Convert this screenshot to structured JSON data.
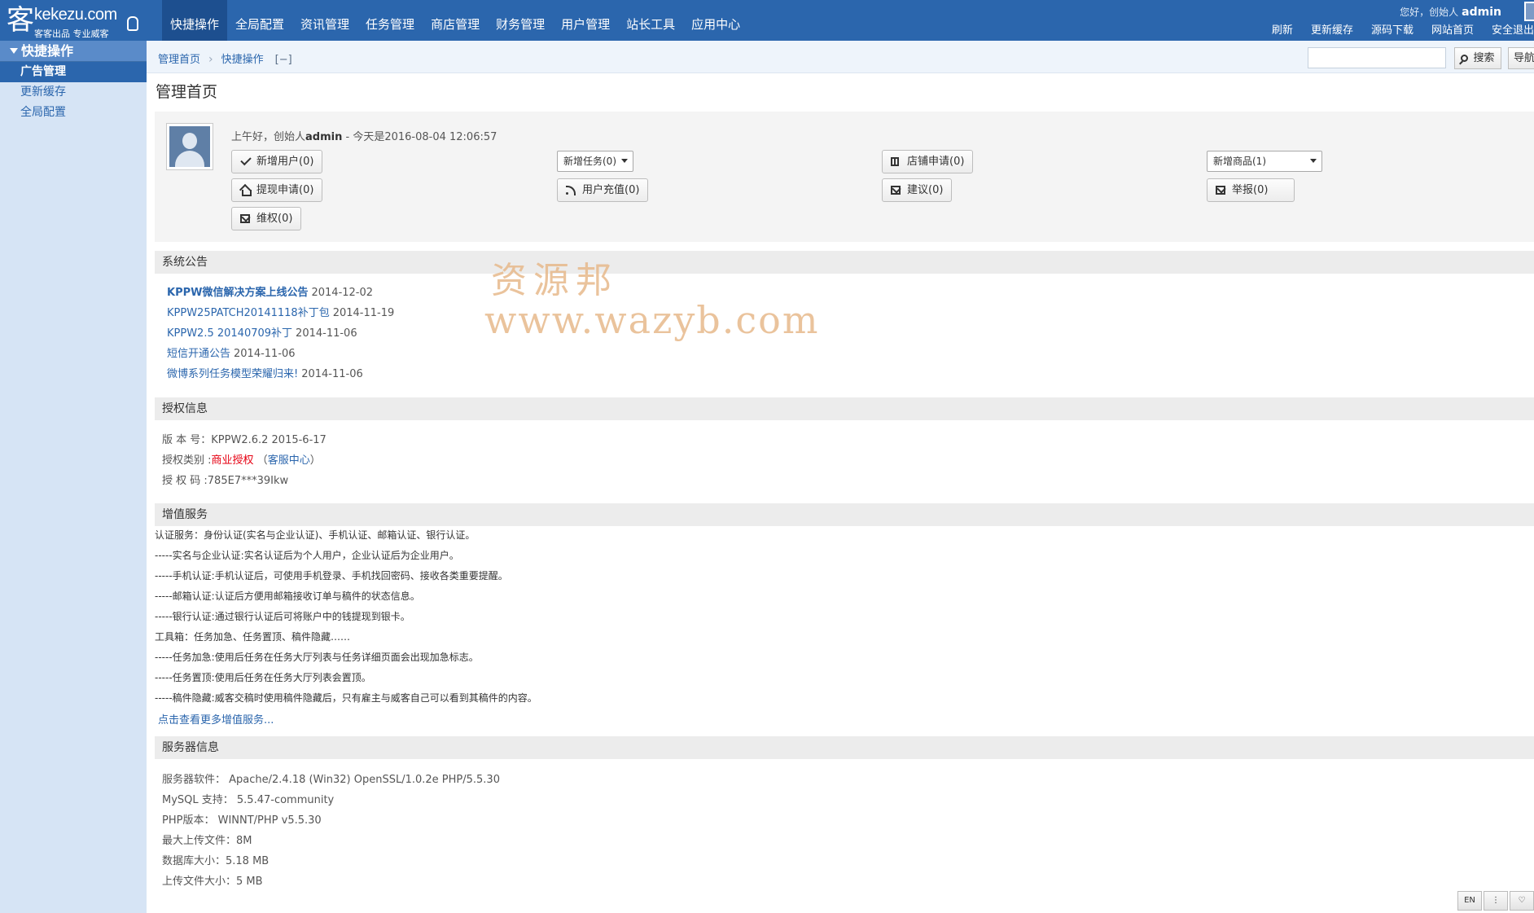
{
  "header": {
    "logo_text": "kekezu.com",
    "logo_sub": "客客出品 专业威客",
    "nav": [
      "快捷操作",
      "全局配置",
      "资讯管理",
      "任务管理",
      "商店管理",
      "财务管理",
      "用户管理",
      "站长工具",
      "应用中心"
    ],
    "greeting": "您好，创始人",
    "username": "admin",
    "links": [
      "刷新",
      "更新缓存",
      "源码下载",
      "网站首页",
      "安全退出"
    ]
  },
  "sidebar": {
    "title": "快捷操作",
    "items": [
      "广告管理",
      "更新缓存",
      "全局配置"
    ]
  },
  "breadcrumb": {
    "home": "管理首页",
    "current": "快捷操作",
    "toggle": "[−]",
    "search_placeholder": "",
    "search_label": "搜索",
    "navmap_label": "导航地图"
  },
  "page": {
    "title": "管理首页",
    "greeting_prefix": "上午好，创始人",
    "greeting_user": "admin",
    "greeting_suffix": " - 今天是2016-08-04 12:06:57",
    "buttons": {
      "new_users": "新增用户(0)",
      "withdraw": "提现申请(0)",
      "rights": "维权(0)",
      "new_tasks": "新增任务(0)",
      "recharge": "用户充值(0)",
      "shop_apply": "店铺申请(0)",
      "suggest": "建议(0)",
      "new_goods": "新增商品(1)",
      "report": "举报(0)"
    },
    "notices_title": "系统公告",
    "notices": [
      {
        "title": "KPPW微信解决方案上线公告",
        "date": "2014-12-02"
      },
      {
        "title": "KPPW25PATCH20141118补丁包",
        "date": "2014-11-19"
      },
      {
        "title": "KPPW2.5 20140709补丁",
        "date": "2014-11-06"
      },
      {
        "title": "短信开通公告",
        "date": "2014-11-06"
      },
      {
        "title": "微博系列任务模型荣耀归来!",
        "date": "2014-11-06"
      }
    ],
    "license_title": "授权信息",
    "license": {
      "version_label": "版 本 号：",
      "version": "KPPW2.6.2 2015-6-17",
      "type_label": "授权类别 :",
      "type": "商业授权",
      "paren_open": "（",
      "service": "客服中心",
      "paren_close": "）",
      "code_label": "授 权 码 :",
      "code": "785E7***39Ikw"
    },
    "vas_title": "增值服务",
    "vas_lines": [
      "认证服务：身份认证(实名与企业认证)、手机认证、邮箱认证、银行认证。",
      "-----实名与企业认证:实名认证后为个人用户，企业认证后为企业用户。",
      "-----手机认证:手机认证后，可使用手机登录、手机找回密码、接收各类重要提醒。",
      "-----邮箱认证:认证后方便用邮箱接收订单与稿件的状态信息。",
      "-----银行认证:通过银行认证后可将账户中的钱提现到银卡。",
      "工具箱：任务加急、任务置顶、稿件隐藏……",
      "-----任务加急:使用后任务在任务大厅列表与任务详细页面会出现加急标志。",
      "-----任务置顶:使用后任务在任务大厅列表会置顶。",
      "-----稿件隐藏:威客交稿时使用稿件隐藏后，只有雇主与威客自己可以看到其稿件的内容。"
    ],
    "vas_more": "点击查看更多增值服务...",
    "server_title": "服务器信息",
    "server": [
      "服务器软件：  Apache/2.4.18 (Win32) OpenSSL/1.0.2e PHP/5.5.30",
      "MySQL 支持：  5.5.47-community",
      "PHP版本：  WINNT/PHP v5.5.30",
      "最大上传文件：8M",
      "数据库大小：5.18 MB",
      "上传文件大小：5 MB"
    ]
  },
  "watermark": {
    "line1": "资源邦",
    "line2": "www.wazyb.com"
  },
  "corner_tools": [
    "EN",
    "⋮",
    "♡"
  ]
}
